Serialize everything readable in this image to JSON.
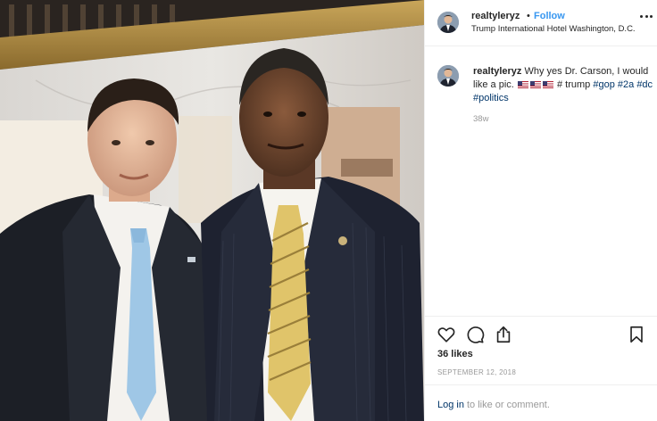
{
  "colors": {
    "link": "#3897f0",
    "hashtag": "#003569",
    "muted": "#999999",
    "text": "#262626"
  },
  "photo": {
    "subject": "photo-of-two-men-in-suits"
  },
  "header": {
    "username": "realtyleryz",
    "dot": "•",
    "follow_label": "Follow",
    "location": "Trump International Hotel Washington, D.C.",
    "more_icon": "more-options-icon"
  },
  "caption": {
    "username": "realtyleryz",
    "text": "Why yes Dr. Carson, I would like a pic.",
    "flags": [
      "us-flag-icon",
      "us-flag-icon",
      "us-flag-icon"
    ],
    "plain_tag": "# trump",
    "hashtags": [
      "#gop",
      "#2a",
      "#dc",
      "#politics"
    ],
    "age": "38w"
  },
  "actions": {
    "icons": [
      "heart-icon",
      "comment-icon",
      "share-icon",
      "bookmark-icon"
    ],
    "likes": "36 likes",
    "date": "SEPTEMBER 12, 2018"
  },
  "footer": {
    "login_label": "Log in",
    "rest_text": "to like or comment."
  }
}
